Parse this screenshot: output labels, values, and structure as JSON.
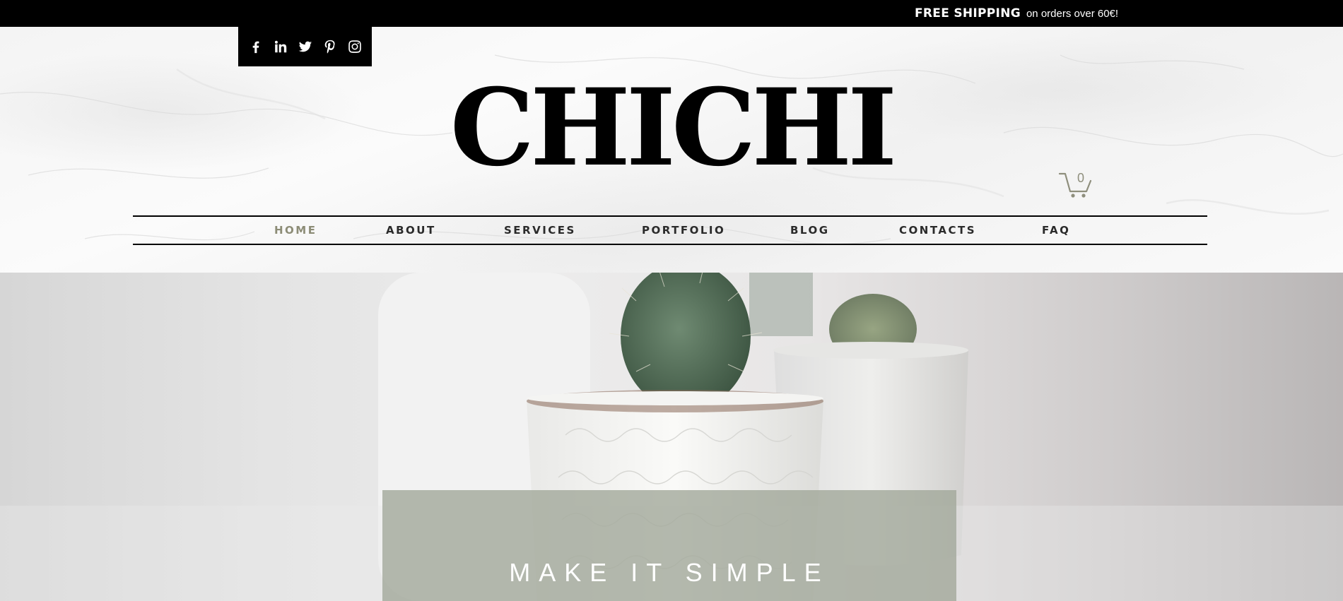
{
  "topbar": {
    "shipping_strong": "FREE SHIPPING",
    "shipping_rest": "on orders over 60€!"
  },
  "social": {
    "items": [
      {
        "icon": "facebook-icon"
      },
      {
        "icon": "linkedin-icon"
      },
      {
        "icon": "twitter-icon"
      },
      {
        "icon": "pinterest-icon"
      },
      {
        "icon": "instagram-icon"
      }
    ]
  },
  "brand": {
    "logo_text": "CHICHI"
  },
  "cart": {
    "count": "0"
  },
  "nav": {
    "items": [
      {
        "label": "HOME",
        "active": true
      },
      {
        "label": "ABOUT",
        "active": false
      },
      {
        "label": "SERVICES",
        "active": false
      },
      {
        "label": "PORTFOLIO",
        "active": false
      },
      {
        "label": "BLOG",
        "active": false
      },
      {
        "label": "CONTACTS",
        "active": false
      },
      {
        "label": "FAQ",
        "active": false
      }
    ]
  },
  "hero": {
    "tagline": "MAKE IT SIMPLE"
  },
  "colors": {
    "topbar_bg": "#000000",
    "nav_active": "#8c8c76",
    "nav_text": "#2a2a2a",
    "tagline_box": "#a0a698",
    "cart_color": "#8e8e7c"
  }
}
